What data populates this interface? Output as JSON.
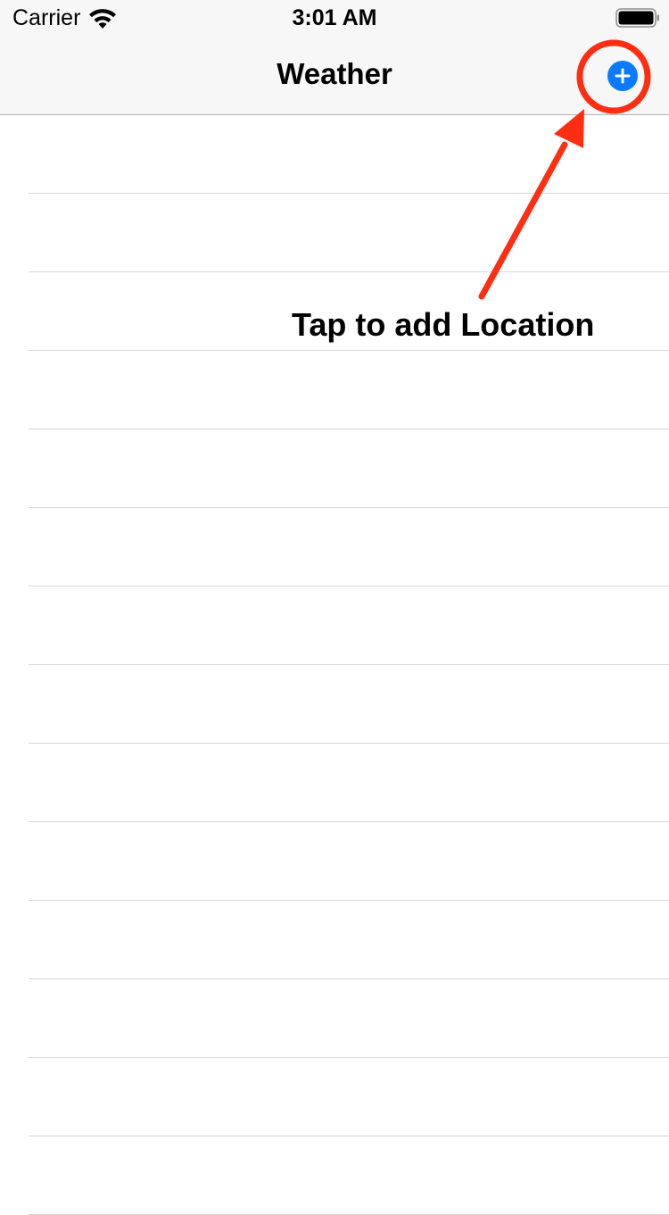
{
  "status_bar": {
    "carrier": "Carrier",
    "time": "3:01 AM",
    "icons": [
      "wifi-icon",
      "battery-icon"
    ]
  },
  "nav_bar": {
    "title": "Weather",
    "add_button_icon": "plus-circle-icon",
    "accent_color": "#0a7aff"
  },
  "table": {
    "row_count": 14,
    "separator_color": "#d8d8d8"
  },
  "annotation": {
    "text": "Tap to add Location",
    "color": "#ff2d12"
  }
}
